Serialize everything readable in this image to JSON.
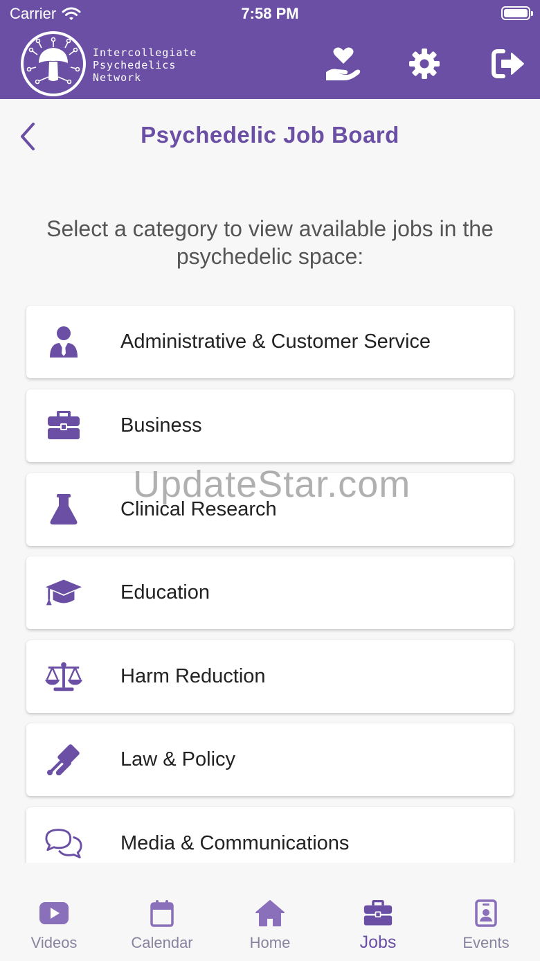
{
  "status_bar": {
    "carrier": "Carrier",
    "time": "7:58 PM"
  },
  "header": {
    "logo_lines": [
      "Intercollegiate",
      "Psychedelics",
      "Network"
    ],
    "icons": [
      "donate-heart-hand-icon",
      "gear-icon",
      "logout-icon"
    ]
  },
  "page": {
    "title": "Psychedelic Job Board",
    "intro": "Select a category to view available jobs in the psychedelic space:"
  },
  "categories": [
    {
      "label": "Administrative & Customer Service",
      "icon": "user-tie-icon"
    },
    {
      "label": "Business",
      "icon": "briefcase-icon"
    },
    {
      "label": "Clinical Research",
      "icon": "flask-icon"
    },
    {
      "label": "Education",
      "icon": "graduation-cap-icon"
    },
    {
      "label": "Harm Reduction",
      "icon": "balance-scale-icon"
    },
    {
      "label": "Law & Policy",
      "icon": "gavel-icon"
    },
    {
      "label": "Media & Communications",
      "icon": "comments-icon"
    }
  ],
  "watermark": "UpdateStar.com",
  "tabs": [
    {
      "label": "Videos",
      "icon": "video-icon",
      "active": false
    },
    {
      "label": "Calendar",
      "icon": "calendar-icon",
      "active": false
    },
    {
      "label": "Home",
      "icon": "home-icon",
      "active": false
    },
    {
      "label": "Jobs",
      "icon": "briefcase-icon",
      "active": true
    },
    {
      "label": "Events",
      "icon": "id-badge-icon",
      "active": false
    }
  ],
  "colors": {
    "brand": "#6a4fa5",
    "background": "#f7f7f7",
    "card": "#ffffff",
    "tab_inactive": "#8a83a0"
  }
}
